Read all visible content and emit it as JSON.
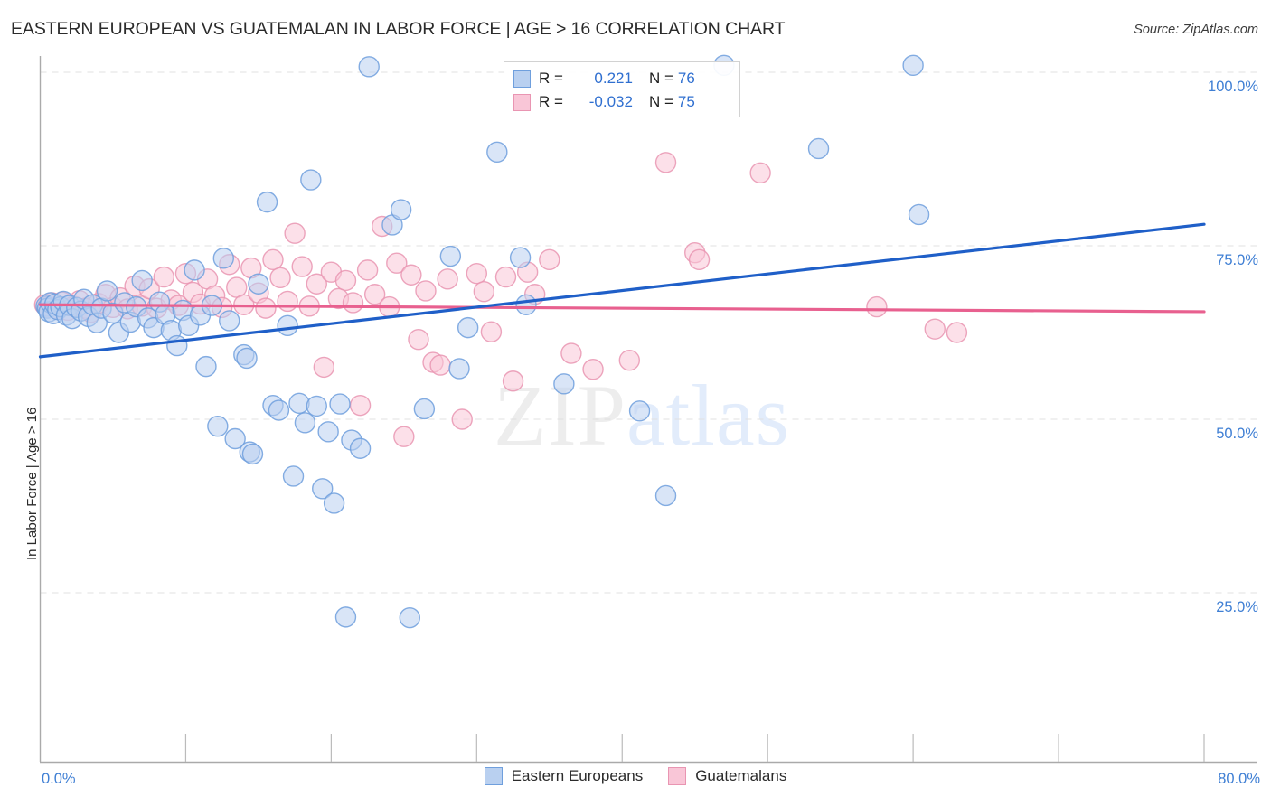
{
  "header": {
    "title": "EASTERN EUROPEAN VS GUATEMALAN IN LABOR FORCE | AGE > 16 CORRELATION CHART",
    "source": "Source: ZipAtlas.com"
  },
  "watermark": {
    "part1": "ZIP",
    "part2": "atlas"
  },
  "stats": {
    "rows": [
      {
        "series": "Eastern Europeans",
        "r_label": "R =",
        "r_value": "0.221",
        "n_label": "N =",
        "n_value": "76",
        "color": "#b9d0f0",
        "border": "#6f9fdd"
      },
      {
        "series": "Guatemalans",
        "r_label": "R =",
        "r_value": "-0.032",
        "n_label": "N =",
        "n_value": "75",
        "color": "#f9c6d7",
        "border": "#e995b2"
      }
    ]
  },
  "legend": {
    "items": [
      {
        "label": "Eastern Europeans",
        "color": "#b9d0f0",
        "border": "#6f9fdd"
      },
      {
        "label": "Guatemalans",
        "color": "#f9c6d7",
        "border": "#e995b2"
      }
    ]
  },
  "chart_data": {
    "type": "scatter",
    "title": "EASTERN EUROPEAN VS GUATEMALAN IN LABOR FORCE | AGE > 16 CORRELATION CHART",
    "xlabel": "",
    "ylabel": "In Labor Force | Age > 16",
    "xlim": [
      0,
      80
    ],
    "ylim": [
      0,
      108.5
    ],
    "grid": true,
    "legend_position": "bottom",
    "xtick_labels": [
      "0.0%",
      "80.0%"
    ],
    "ytick_labels": [
      "100.0%",
      "75.0%",
      "50.0%",
      "25.0%"
    ],
    "ytick_values": [
      100,
      75,
      50,
      25
    ],
    "xtick_values": [
      0,
      80
    ],
    "colors": {
      "blue_fill": "#b9d0f0",
      "blue_stroke": "#6f9fdd",
      "pink_fill": "#f9c6d7",
      "pink_stroke": "#e995b2",
      "blue_line": "#1f5fc8",
      "pink_line": "#e8608f",
      "tick_text": "#3f7fd4",
      "gridline": "#e0e0e0"
    },
    "series": [
      {
        "name": "Eastern Europeans",
        "r": 0.221,
        "n": 76,
        "trendline": {
          "x0": 0,
          "y0": 59.0,
          "x1": 80,
          "y1": 78.1
        },
        "points": [
          [
            0.4,
            66.3
          ],
          [
            0.5,
            66.0
          ],
          [
            0.6,
            65.5
          ],
          [
            0.7,
            66.8
          ],
          [
            0.9,
            65.2
          ],
          [
            1.0,
            66.6
          ],
          [
            1.2,
            65.8
          ],
          [
            1.4,
            66.2
          ],
          [
            1.6,
            67.0
          ],
          [
            1.8,
            65.0
          ],
          [
            2.0,
            66.4
          ],
          [
            2.2,
            64.5
          ],
          [
            2.5,
            66.1
          ],
          [
            2.8,
            65.6
          ],
          [
            3.0,
            67.3
          ],
          [
            3.3,
            64.8
          ],
          [
            3.6,
            66.5
          ],
          [
            3.9,
            63.9
          ],
          [
            4.2,
            66.0
          ],
          [
            4.6,
            68.5
          ],
          [
            5.0,
            65.3
          ],
          [
            5.4,
            62.5
          ],
          [
            5.8,
            66.8
          ],
          [
            6.2,
            64.0
          ],
          [
            6.6,
            66.2
          ],
          [
            7.0,
            70.0
          ],
          [
            7.4,
            64.6
          ],
          [
            7.8,
            63.2
          ],
          [
            8.2,
            66.9
          ],
          [
            8.6,
            65.1
          ],
          [
            9.0,
            62.8
          ],
          [
            9.4,
            60.6
          ],
          [
            9.8,
            65.7
          ],
          [
            10.2,
            63.5
          ],
          [
            10.6,
            71.5
          ],
          [
            11.0,
            65.0
          ],
          [
            11.4,
            57.6
          ],
          [
            11.8,
            66.4
          ],
          [
            12.2,
            49.0
          ],
          [
            12.6,
            73.2
          ],
          [
            13.0,
            64.2
          ],
          [
            13.4,
            47.2
          ],
          [
            14.0,
            59.3
          ],
          [
            14.2,
            58.8
          ],
          [
            14.4,
            45.3
          ],
          [
            14.6,
            45.0
          ],
          [
            15.0,
            69.5
          ],
          [
            15.6,
            81.3
          ],
          [
            16.0,
            52.0
          ],
          [
            16.4,
            51.3
          ],
          [
            17.0,
            63.5
          ],
          [
            17.4,
            41.8
          ],
          [
            17.8,
            52.3
          ],
          [
            18.2,
            49.5
          ],
          [
            18.6,
            84.5
          ],
          [
            19.0,
            51.9
          ],
          [
            19.4,
            40.0
          ],
          [
            19.8,
            48.2
          ],
          [
            20.2,
            37.9
          ],
          [
            20.6,
            52.2
          ],
          [
            21.0,
            21.5
          ],
          [
            21.4,
            47.0
          ],
          [
            22.0,
            45.8
          ],
          [
            22.6,
            100.8
          ],
          [
            24.2,
            78.0
          ],
          [
            24.8,
            80.2
          ],
          [
            25.4,
            21.4
          ],
          [
            26.4,
            51.5
          ],
          [
            28.2,
            73.5
          ],
          [
            28.8,
            57.3
          ],
          [
            29.4,
            63.2
          ],
          [
            31.4,
            88.5
          ],
          [
            33.0,
            73.3
          ],
          [
            33.4,
            66.5
          ],
          [
            36.0,
            55.1
          ],
          [
            41.2,
            51.2
          ],
          [
            43.0,
            39.0
          ],
          [
            47.0,
            101.0
          ],
          [
            53.5,
            89.0
          ],
          [
            60.0,
            101.0
          ],
          [
            60.4,
            79.5
          ]
        ]
      },
      {
        "name": "Guatemalans",
        "r": -0.032,
        "n": 75,
        "trendline": {
          "x0": 0,
          "y0": 66.5,
          "x1": 80,
          "y1": 65.5
        },
        "points": [
          [
            0.3,
            66.5
          ],
          [
            0.5,
            66.2
          ],
          [
            0.8,
            66.8
          ],
          [
            1.1,
            66.0
          ],
          [
            1.5,
            66.9
          ],
          [
            1.9,
            65.7
          ],
          [
            2.3,
            66.3
          ],
          [
            2.7,
            67.1
          ],
          [
            3.1,
            66.0
          ],
          [
            3.5,
            65.4
          ],
          [
            4.0,
            66.7
          ],
          [
            4.5,
            68.0
          ],
          [
            5.0,
            66.1
          ],
          [
            5.5,
            67.5
          ],
          [
            6.0,
            65.9
          ],
          [
            6.5,
            69.2
          ],
          [
            7.0,
            66.3
          ],
          [
            7.5,
            68.8
          ],
          [
            8.0,
            66.0
          ],
          [
            8.5,
            70.5
          ],
          [
            9.0,
            67.2
          ],
          [
            9.5,
            66.4
          ],
          [
            10.0,
            71.0
          ],
          [
            10.5,
            68.3
          ],
          [
            11.0,
            66.6
          ],
          [
            11.5,
            70.2
          ],
          [
            12.0,
            67.8
          ],
          [
            12.5,
            66.1
          ],
          [
            13.0,
            72.3
          ],
          [
            13.5,
            69.0
          ],
          [
            14.0,
            66.5
          ],
          [
            14.5,
            71.8
          ],
          [
            15.0,
            68.2
          ],
          [
            15.5,
            66.0
          ],
          [
            16.0,
            73.0
          ],
          [
            16.5,
            70.4
          ],
          [
            17.0,
            67.0
          ],
          [
            17.5,
            76.8
          ],
          [
            18.0,
            72.0
          ],
          [
            18.5,
            66.3
          ],
          [
            19.0,
            69.5
          ],
          [
            19.5,
            57.5
          ],
          [
            20.0,
            71.2
          ],
          [
            20.5,
            67.4
          ],
          [
            21.0,
            70.0
          ],
          [
            21.5,
            66.8
          ],
          [
            22.0,
            52.0
          ],
          [
            22.5,
            71.5
          ],
          [
            23.0,
            68.0
          ],
          [
            23.5,
            77.8
          ],
          [
            24.0,
            66.2
          ],
          [
            24.5,
            72.5
          ],
          [
            25.0,
            47.5
          ],
          [
            25.5,
            70.8
          ],
          [
            26.0,
            61.5
          ],
          [
            26.5,
            68.5
          ],
          [
            27.0,
            58.2
          ],
          [
            27.5,
            57.8
          ],
          [
            28.0,
            70.2
          ],
          [
            29.0,
            50.0
          ],
          [
            30.0,
            71.0
          ],
          [
            30.5,
            68.4
          ],
          [
            31.0,
            62.6
          ],
          [
            32.0,
            70.5
          ],
          [
            32.5,
            55.5
          ],
          [
            33.5,
            71.2
          ],
          [
            34.0,
            68.0
          ],
          [
            35.0,
            73.0
          ],
          [
            36.5,
            59.5
          ],
          [
            38.0,
            57.2
          ],
          [
            40.5,
            58.5
          ],
          [
            43.0,
            87.0
          ],
          [
            45.0,
            74.0
          ],
          [
            45.3,
            73.0
          ],
          [
            49.5,
            85.5
          ],
          [
            57.5,
            66.2
          ],
          [
            61.5,
            63.0
          ],
          [
            63.0,
            62.5
          ]
        ]
      }
    ]
  },
  "axis": {
    "y_ticks": [
      "100.0%",
      "75.0%",
      "50.0%",
      "25.0%"
    ],
    "x_min": "0.0%",
    "x_max": "80.0%",
    "y_title": "In Labor Force | Age > 16"
  }
}
